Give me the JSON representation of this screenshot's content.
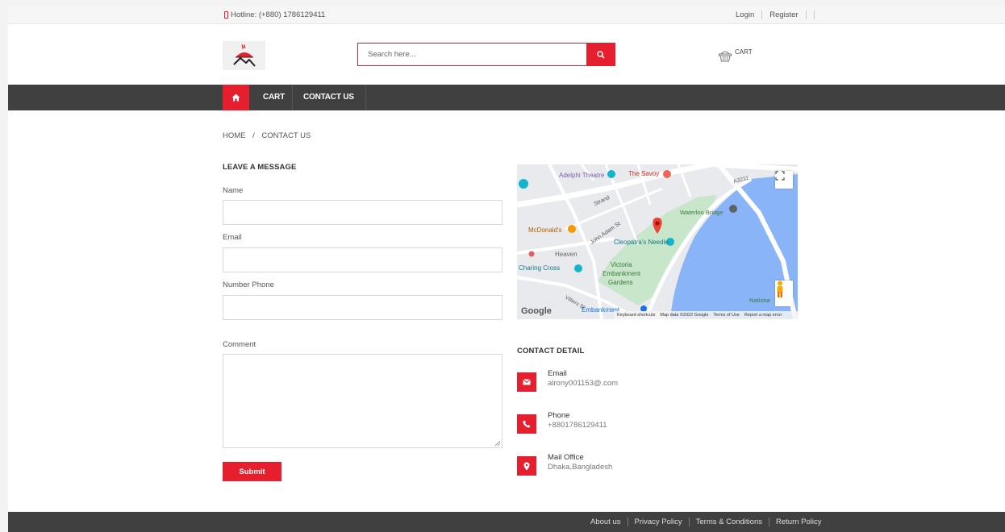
{
  "topbar": {
    "hotline": "Hotline: (+880) 1786129411",
    "login": "Login",
    "register": "Register"
  },
  "header": {
    "search_placeholder": "Search here...",
    "cart_label": "CART"
  },
  "nav": {
    "cart": "CART",
    "contact": "CONTACT US"
  },
  "breadcrumb": {
    "home": "HOME",
    "separator": "/",
    "current": "CONTACT US"
  },
  "form": {
    "title": "LEAVE A MESSAGE",
    "name_label": "Name",
    "email_label": "Email",
    "phone_label": "Number Phone",
    "comment_label": "Comment",
    "submit_label": "Submit"
  },
  "map": {
    "labels": {
      "adelphi": "Adelphi Theatre",
      "savoy": "The Savoy",
      "a3211": "A3211",
      "strand": "Strand",
      "waterloo": "Waterloo Bridge",
      "mcdonalds": "McDonald's",
      "john_adam": "John Adam St",
      "cleopatra": "Cleopatra's Needle",
      "heaven": "Heaven",
      "charing_cross": "Charing Cross",
      "victoria": "Victoria",
      "embankment_label": "Embankment",
      "gardens": "Gardens",
      "embankment_station": "Embankment",
      "villiers": "Villiers St",
      "nationa": "Nationa",
      "google": "Google"
    },
    "footer": {
      "shortcuts": "Keyboard shortcuts",
      "data": "Map data ©2022 Google",
      "terms": "Terms of Use",
      "report": "Report a map error"
    }
  },
  "contact_detail": {
    "title": "CONTACT DETAIL",
    "items": [
      {
        "title": "Email",
        "value": "alrony001153@.com"
      },
      {
        "title": "Phone",
        "value": "+8801786129411"
      },
      {
        "title": "Mail Office",
        "value": "Dhaka,Bangladesh"
      }
    ]
  },
  "footer": {
    "links": [
      "About us",
      "Privacy Policy",
      "Terms & Conditions",
      "Return Policy"
    ]
  },
  "colors": {
    "accent": "#e51f2e",
    "dark_bar": "#404040",
    "water": "#8ab4f8",
    "park": "#c8e6c9"
  }
}
